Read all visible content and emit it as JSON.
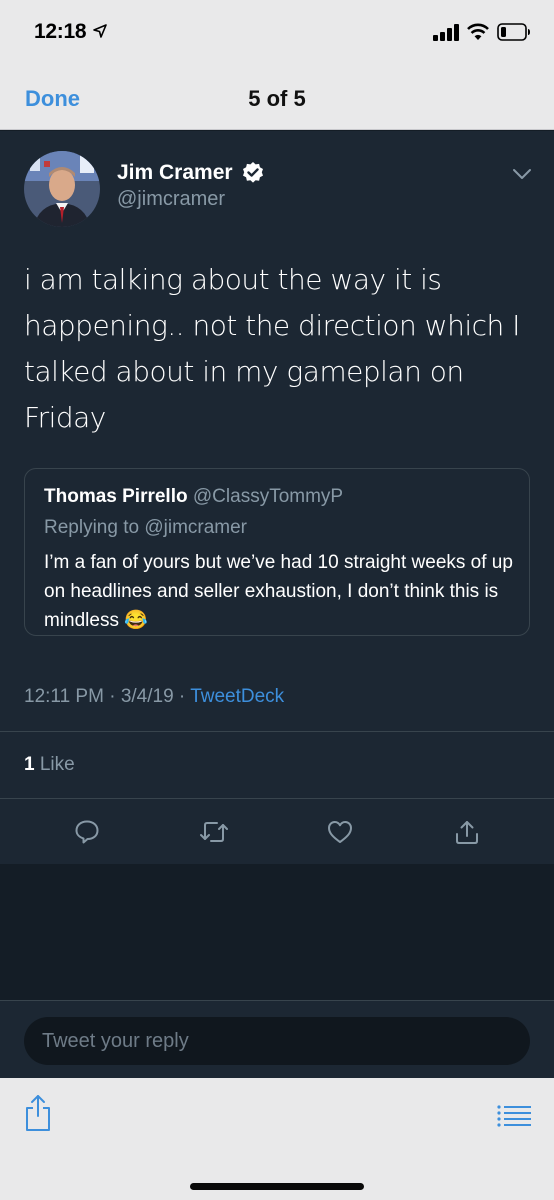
{
  "status": {
    "time": "12:18"
  },
  "nav": {
    "done_label": "Done",
    "title": "5 of 5"
  },
  "tweet": {
    "author_name": "Jim Cramer",
    "author_handle": "@jimcramer",
    "text": "i am talking about the way it is happening.. not the direction which I talked about in my gameplan on Friday",
    "quote": {
      "author_name": "Thomas Pirrello",
      "author_handle": "@ClassyTommyP",
      "replying_to": "Replying to @jimcramer",
      "text": "I’m a fan of yours but we’ve had 10 straight weeks of up on headlines and seller exhaustion, I don’t think this is mindless 😂"
    },
    "meta": {
      "time": "12:11 PM",
      "separator": " · ",
      "date": "3/4/19",
      "source": "TweetDeck"
    },
    "likes": {
      "count": "1",
      "label": "Like"
    }
  },
  "reply": {
    "placeholder": "Tweet your reply"
  },
  "colors": {
    "accent": "#3d8fdc",
    "card_bg": "#1c2733",
    "page_bg": "#141d26",
    "muted": "#8899a6",
    "border": "#38444d"
  },
  "icons": [
    "location-arrow-icon",
    "signal-icon",
    "wifi-icon",
    "battery-icon",
    "verified-icon",
    "chevron-down-icon",
    "reply-icon",
    "retweet-icon",
    "heart-icon",
    "share-icon",
    "list-icon"
  ]
}
